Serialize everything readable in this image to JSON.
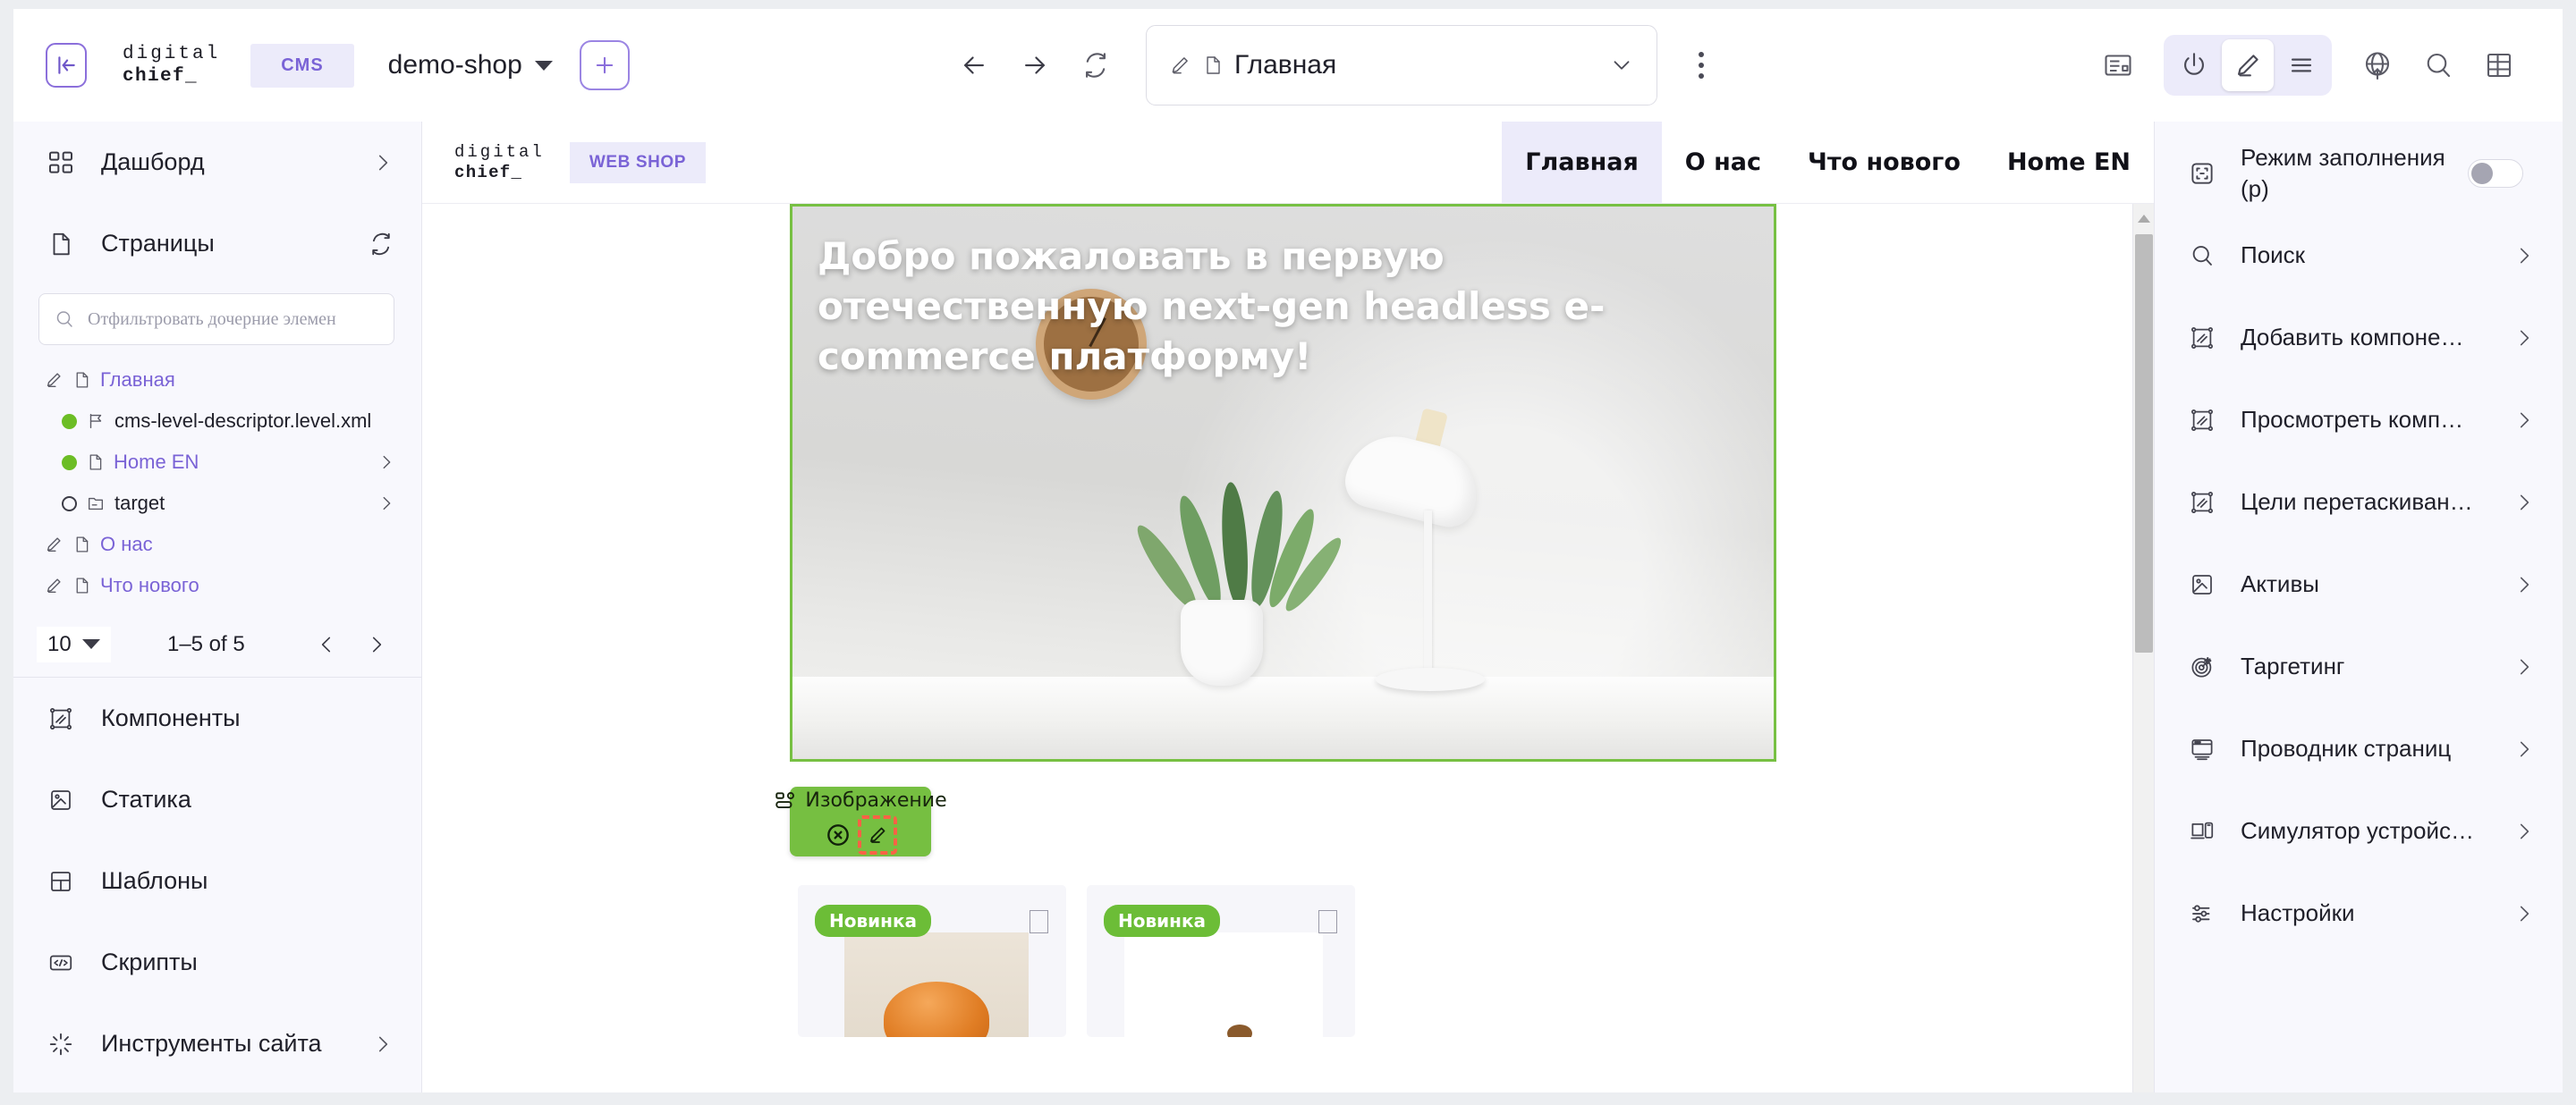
{
  "toolbar": {
    "collapse_icon": "collapse-panel-icon",
    "brand_line1": "digital",
    "brand_line2": "chief_",
    "cms_chip": "CMS",
    "site_name": "demo-shop",
    "add_label": "+",
    "back_icon": "arrow-left-icon",
    "forward_icon": "arrow-right-icon",
    "refresh_icon": "refresh-icon",
    "page_field_value": "Главная",
    "page_field_edit_icon": "pencil-icon",
    "page_field_doc_icon": "document-icon",
    "page_field_chevron": "chevron-down-icon",
    "kebab_icon": "more-vertical-icon",
    "right_icons": [
      {
        "name": "layout-panel-icon",
        "active": false
      },
      {
        "name": "power-icon",
        "active": false
      },
      {
        "name": "edit-pencil-icon",
        "active": true
      },
      {
        "name": "menu-lines-icon",
        "active": false
      },
      {
        "name": "globe-upload-icon",
        "active": false
      },
      {
        "name": "search-icon",
        "active": false
      },
      {
        "name": "grid-table-icon",
        "active": false
      }
    ]
  },
  "sidebar": {
    "dashboard": {
      "label": "Дашборд",
      "icon": "dashboard-icon",
      "chevron": "chevron-right-icon"
    },
    "pages": {
      "label": "Страницы",
      "icon": "page-icon",
      "refresh_icon": "refresh-icon"
    },
    "filter_placeholder": "Отфильтровать дочерние элемен",
    "filter_value": "",
    "filter_icon": "search-icon",
    "tree": [
      {
        "label": "Главная",
        "icons": [
          "pencil-icon",
          "document-icon"
        ],
        "status": "none",
        "chevron": false,
        "purple": true
      },
      {
        "label": "cms-level-descriptor.level.xml",
        "icons": [
          "flag-icon"
        ],
        "status": "green",
        "chevron": false,
        "purple": false,
        "indent": true
      },
      {
        "label": "Home EN",
        "icons": [
          "document-icon"
        ],
        "status": "green",
        "chevron": true,
        "purple": true,
        "indent": true
      },
      {
        "label": "target",
        "icons": [
          "folder-icon"
        ],
        "status": "empty",
        "chevron": true,
        "purple": false,
        "indent": true
      },
      {
        "label": "О нас",
        "icons": [
          "pencil-icon",
          "document-icon"
        ],
        "status": "none",
        "chevron": false,
        "purple": true
      },
      {
        "label": "Что нового",
        "icons": [
          "pencil-icon",
          "document-icon"
        ],
        "status": "none",
        "chevron": false,
        "purple": true
      }
    ],
    "pager": {
      "page_size": "10",
      "range": "1–5 of 5",
      "prev_icon": "chevron-left-icon",
      "next_icon": "chevron-right-icon"
    },
    "sections": [
      {
        "label": "Компоненты",
        "icon": "component-icon",
        "chevron": false
      },
      {
        "label": "Статика",
        "icon": "image-icon",
        "chevron": false
      },
      {
        "label": "Шаблоны",
        "icon": "template-icon",
        "chevron": false
      },
      {
        "label": "Скрипты",
        "icon": "code-icon",
        "chevron": false
      },
      {
        "label": "Инструменты сайта",
        "icon": "tools-icon",
        "chevron": true
      }
    ]
  },
  "canvas": {
    "site_brand_line1": "digital",
    "site_brand_line2": "chief_",
    "site_chip": "WEB SHOP",
    "nav": [
      {
        "label": "Главная",
        "active": true
      },
      {
        "label": "О нас",
        "active": false
      },
      {
        "label": "Что нового",
        "active": false
      },
      {
        "label": "Home EN",
        "active": false
      }
    ],
    "hero_heading": "Добро пожаловать в первую отечественную next-gen headless e-commerce платформу!",
    "selection_color": "#77c043",
    "component_badge": {
      "label": "Изображение",
      "component_icon": "component-blocks-icon",
      "remove_icon": "remove-circle-icon",
      "edit_icon": "pencil-icon",
      "edit_highlight_color": "#fb6245"
    },
    "cards": [
      {
        "badge": "Новинка",
        "checkbox_icon": "checkbox-icon"
      },
      {
        "badge": "Новинка",
        "checkbox_icon": "checkbox-icon"
      }
    ]
  },
  "right_panel": {
    "items": [
      {
        "label": "Режим заполнения (p)",
        "icon": "fill-mode-icon",
        "control": "toggle",
        "toggle_on": false
      },
      {
        "label": "Поиск",
        "icon": "search-icon",
        "control": "chevron"
      },
      {
        "label": "Добавить компоне…",
        "icon": "component-icon",
        "control": "chevron"
      },
      {
        "label": "Просмотреть комп…",
        "icon": "component-icon",
        "control": "chevron"
      },
      {
        "label": "Цели перетаскиван…",
        "icon": "component-icon",
        "control": "chevron"
      },
      {
        "label": "Активы",
        "icon": "image-icon",
        "control": "chevron"
      },
      {
        "label": "Таргетинг",
        "icon": "target-icon",
        "control": "chevron"
      },
      {
        "label": "Проводник страниц",
        "icon": "page-explorer-icon",
        "control": "chevron"
      },
      {
        "label": "Симулятор устройс…",
        "icon": "device-simulator-icon",
        "control": "chevron"
      },
      {
        "label": "Настройки",
        "icon": "settings-sliders-icon",
        "control": "chevron"
      }
    ]
  },
  "colors": {
    "accent_purple": "#7a63d6",
    "chip_bg": "#ecebfa",
    "selection_green": "#77c043",
    "badge_green": "#6cbd37",
    "highlight_orange": "#fb6245"
  }
}
